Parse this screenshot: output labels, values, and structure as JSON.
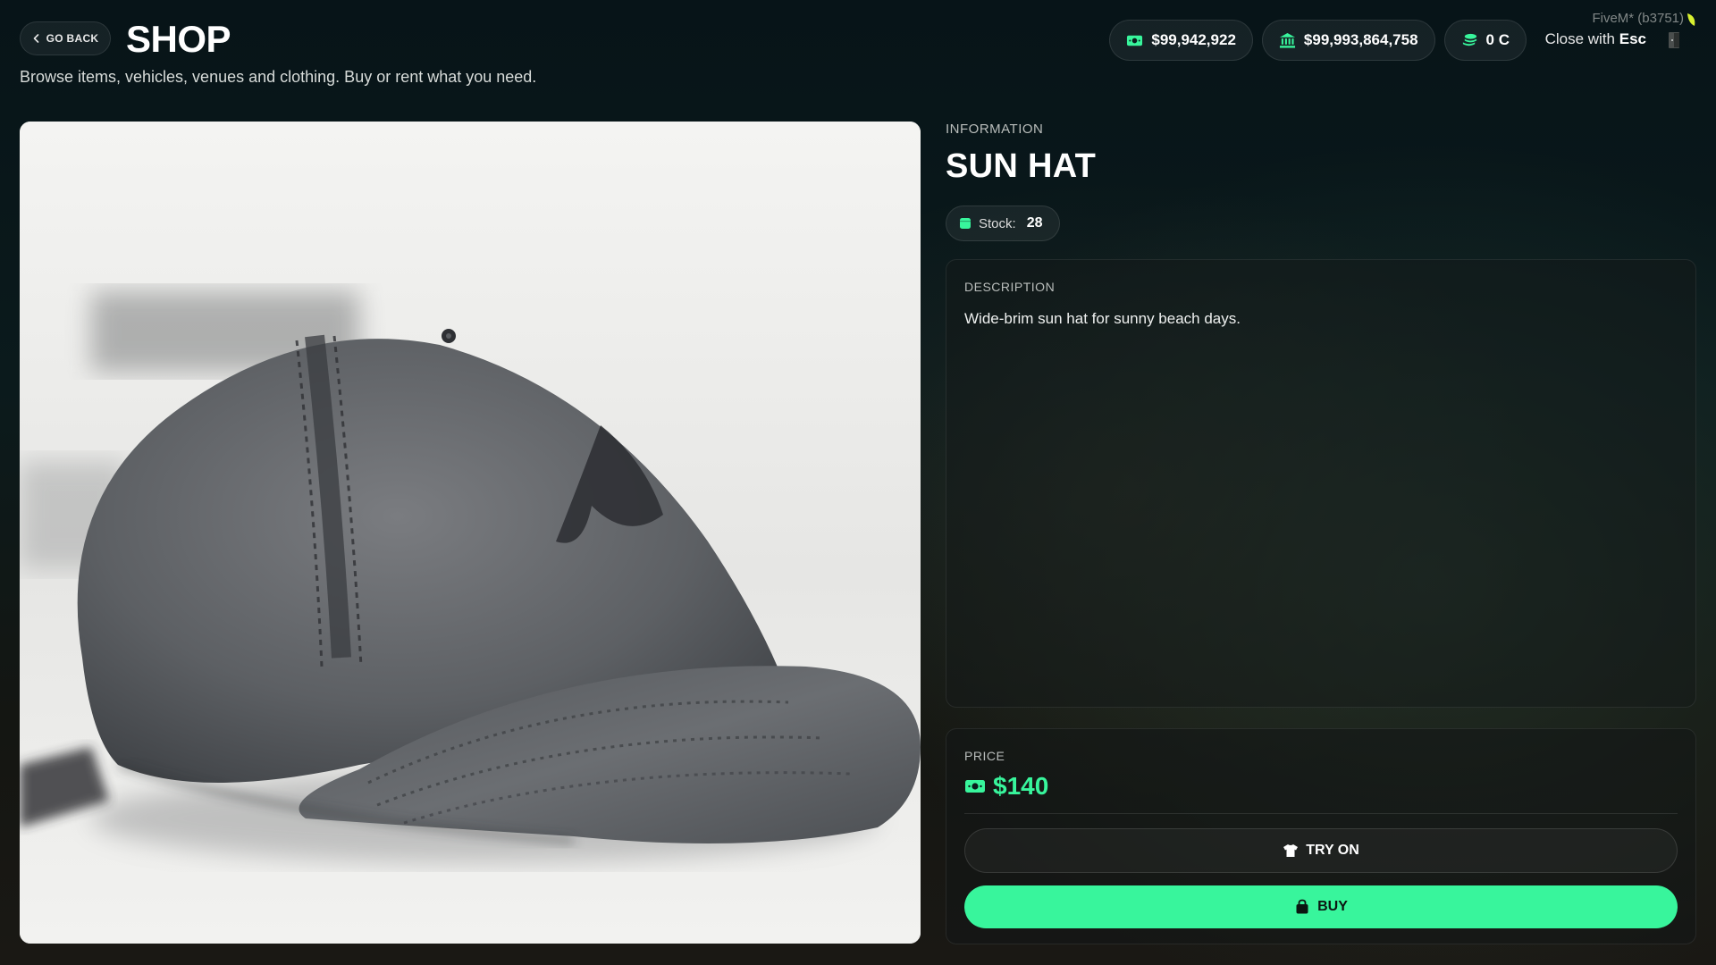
{
  "header": {
    "back_label": "GO BACK",
    "title": "SHOP",
    "subtitle": "Browse items, vehicles, venues and clothing. Buy or rent what you need."
  },
  "balances": [
    {
      "icon": "cash-icon",
      "value": "$99,942,922"
    },
    {
      "icon": "bank-icon",
      "value": "$99,993,864,758"
    },
    {
      "icon": "coins-icon",
      "value": "0 C"
    }
  ],
  "close": {
    "prefix": "Close with",
    "key": "Esc"
  },
  "system": {
    "label": "FiveM* (b3751)"
  },
  "product": {
    "section_label": "INFORMATION",
    "name": "SUN HAT",
    "stock_label": "Stock:",
    "stock_value": "28",
    "image_icon": "cap-photo"
  },
  "description": {
    "label": "DESCRIPTION",
    "text": "Wide-brim sun hat for sunny beach days."
  },
  "price": {
    "label": "PRICE",
    "value": "$140"
  },
  "actions": {
    "try_on": "TRY ON",
    "buy": "BUY"
  },
  "colors": {
    "accent": "#38f59c",
    "background": "#0b1a1c"
  }
}
